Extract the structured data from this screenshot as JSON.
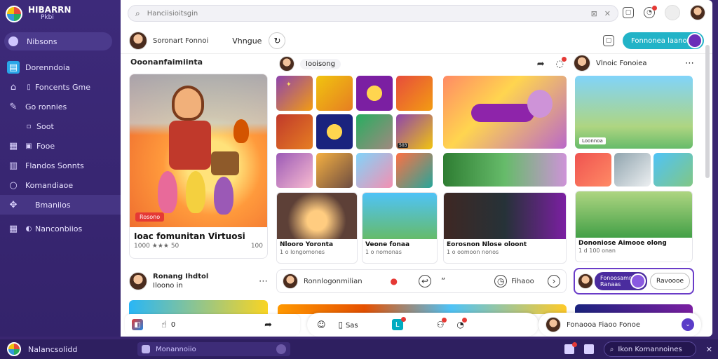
{
  "sidebar": {
    "brand_title": "HIBARRN",
    "brand_sub": "Pkbi",
    "top_item": "Nibsons",
    "items": [
      {
        "label": "Dorenndoia",
        "icon": "calendar-icon"
      },
      {
        "label": "Foncents Gme",
        "icon": "home-icon"
      },
      {
        "label": "Go ronnies",
        "icon": "pencil-icon"
      },
      {
        "label": "Soot",
        "icon": "folder-icon"
      },
      {
        "label": "Fooe",
        "icon": "store-icon"
      },
      {
        "label": "Flandos Sonnts",
        "icon": "book-icon"
      },
      {
        "label": "Komandiaoe",
        "icon": "search-icon"
      },
      {
        "label": "Bmaniios",
        "icon": "puzzle-icon"
      },
      {
        "label": "Nanconbiios",
        "icon": "grid-icon"
      }
    ]
  },
  "topbar": {
    "search_placeholder": "Hanciisioitsgin"
  },
  "subbar": {
    "user_label": "Soronart Fonnoi",
    "view_label": "Vhngue",
    "primary_button": "Fonnonea laanos"
  },
  "left_column": {
    "section_title": "Ooonanfaimiinta",
    "feature_tag": "Rosono",
    "feature_title": "Ioac fomunitan Virtuosi",
    "feature_meta_left": "1000 ★★★ 50",
    "feature_meta_right": "100",
    "mini_name": "Ronang Ihdtol",
    "mini_sub": "Iloono in"
  },
  "center": {
    "head_pill": "Iooisong",
    "thumb_tags": [
      "",
      "",
      "",
      "",
      "",
      "",
      "",
      "503",
      "",
      "",
      "",
      ""
    ],
    "video_cards": [
      {
        "title": "Nlooro Yoronta",
        "meta": "1 o longomones"
      },
      {
        "title": "Veone fonaa",
        "meta": "1 o nomonas"
      },
      {
        "title": "Eorosnon Nlose oloont",
        "meta": "1 o oomoon nonos"
      },
      {
        "title": "Dononiose Aimooe olong",
        "meta": "1 d 100 onan"
      }
    ],
    "comment_text": "Ronnlogonmilian",
    "comment_pill": "Fihaoo"
  },
  "right_column": {
    "head_label": "Vlnoic Fonoiea",
    "big_tag": "Loonnoa",
    "sel_button_line1": "Fonoosamn",
    "sel_button_line2": "Ranaas",
    "sel_pill": "Ravoooe"
  },
  "bottom_toolbar": {
    "left_count": "0",
    "mid_label": "Sas",
    "right_text": "Fonaooa Fiaoo Fonoe"
  },
  "taskbar": {
    "title": "Nalancsolidd",
    "input_placeholder": "Monannoiio",
    "search_label": "Ikon Komannoines"
  }
}
